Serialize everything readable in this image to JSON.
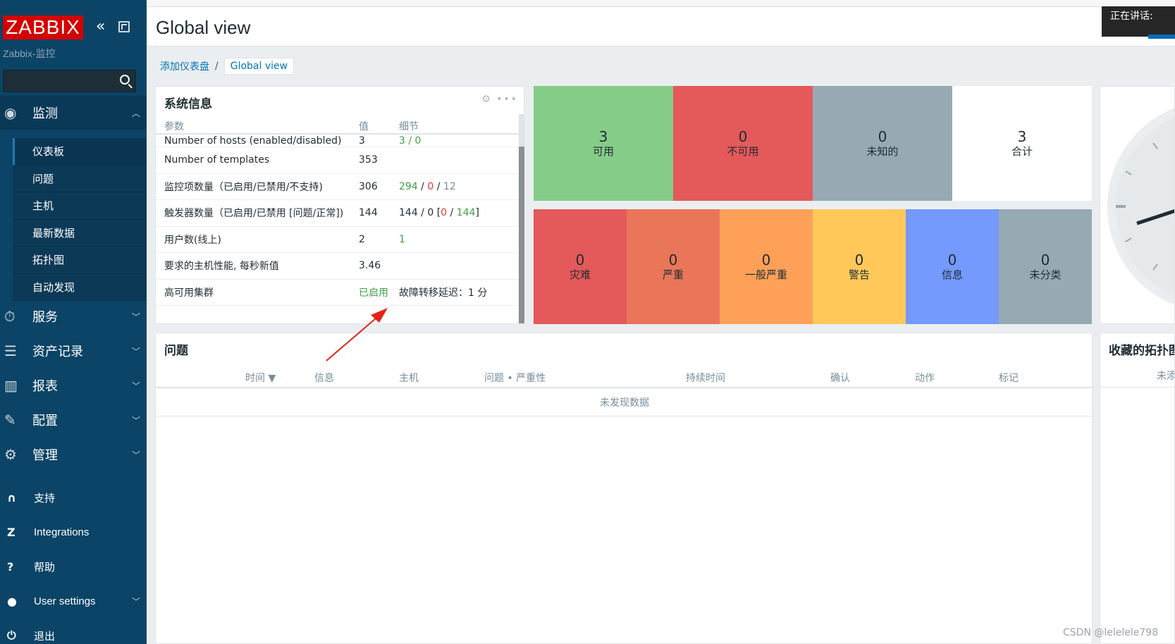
{
  "sidebar": {
    "logo": "ZABBIX",
    "server_name": "Zabbix-监控",
    "search_placeholder": "",
    "groups": [
      {
        "label": "监测",
        "icon": "eye-icon"
      },
      {
        "label": "服务",
        "icon": "stopwatch-icon"
      },
      {
        "label": "资产记录",
        "icon": "list-icon"
      },
      {
        "label": "报表",
        "icon": "bar-chart-icon"
      },
      {
        "label": "配置",
        "icon": "wrench-icon"
      },
      {
        "label": "管理",
        "icon": "gear-icon"
      }
    ],
    "monitoring_items": [
      "仪表板",
      "问题",
      "主机",
      "最新数据",
      "拓扑图",
      "自动发现"
    ],
    "bottom_items": [
      {
        "label": "支持",
        "icon": "headset-icon"
      },
      {
        "label": "Integrations",
        "icon": "z-icon"
      },
      {
        "label": "帮助",
        "icon": "question-icon"
      },
      {
        "label": "User settings",
        "icon": "user-icon"
      },
      {
        "label": "退出",
        "icon": "power-icon"
      }
    ]
  },
  "header": {
    "title": "Global view",
    "speaker_label": "正在讲话:"
  },
  "breadcrumb": {
    "parent": "添加仪表盘",
    "separator": "/",
    "current": "Global view"
  },
  "system_info": {
    "title": "系统信息",
    "columns": [
      "参数",
      "值",
      "细节"
    ],
    "cut_row": {
      "param": "Number of hosts (enabled/disabled)",
      "value": "3",
      "detail": "3 / 0"
    },
    "rows": [
      {
        "param": "Number of templates",
        "value": "353"
      },
      {
        "param": "监控项数量（已启用/已禁用/不支持)",
        "value": "306",
        "d_green": "294",
        "d_sep1": " / ",
        "d_red": "0",
        "d_sep2": " / ",
        "d_grey": "12"
      },
      {
        "param": "触发器数量（已启用/已禁用 [问题/正常])",
        "value": "144",
        "d_plain": "144 / 0 [",
        "d_red": "0",
        "d_sep": " / ",
        "d_green": "144",
        "d_end": "]"
      },
      {
        "param": "用户数(线上)",
        "value": "2",
        "d_green": "1"
      },
      {
        "param": "要求的主机性能, 每秒新值",
        "value": "3.46"
      },
      {
        "param": "高可用集群",
        "value": "已启用",
        "detail": "故障转移延迟：1 分"
      }
    ]
  },
  "host_availability": [
    {
      "num": "3",
      "label": "可用",
      "color": "#86cc89"
    },
    {
      "num": "0",
      "label": "不可用",
      "color": "#e45959"
    },
    {
      "num": "0",
      "label": "未知的",
      "color": "#97aab3"
    },
    {
      "num": "3",
      "label": "合计",
      "color": "#ffffff"
    }
  ],
  "problem_severity": [
    {
      "num": "0",
      "label": "灾难",
      "color": "#e45959"
    },
    {
      "num": "0",
      "label": "严重",
      "color": "#e97659"
    },
    {
      "num": "0",
      "label": "一般严重",
      "color": "#ffa059"
    },
    {
      "num": "0",
      "label": "警告",
      "color": "#ffc859"
    },
    {
      "num": "0",
      "label": "信息",
      "color": "#7499ff"
    },
    {
      "num": "0",
      "label": "未分类",
      "color": "#97aab3"
    }
  ],
  "problems": {
    "title": "问题",
    "columns": [
      "时间 ▼",
      "信息",
      "主机",
      "问题 • 严重性",
      "持续时间",
      "确认",
      "动作",
      "标记"
    ],
    "no_data": "未发现数据"
  },
  "favorite_maps": {
    "title": "收藏的拓扑图",
    "subtitle": "未添"
  },
  "watermark": "CSDN @lelelele798"
}
